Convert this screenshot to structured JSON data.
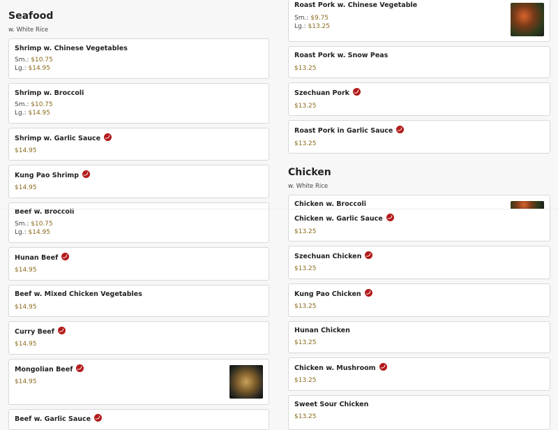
{
  "seafood": {
    "title": "Seafood",
    "subtitle": "w. White Rice",
    "items": [
      {
        "name": "Shrimp w. Chinese Vegetables",
        "sm_label": "Sm.:",
        "sm": "$10.75",
        "lg_label": "Lg.:",
        "lg": "$14.95"
      },
      {
        "name": "Shrimp w. Broccoli",
        "sm_label": "Sm.:",
        "sm": "$10.75",
        "lg_label": "Lg.:",
        "lg": "$14.95"
      },
      {
        "name": "Shrimp w. Garlic Sauce",
        "price": "$14.95"
      },
      {
        "name": "Kung Pao Shrimp",
        "price": "$14.95"
      }
    ]
  },
  "beef": {
    "items": [
      {
        "name": "Beef w. Broccoli",
        "sm_label": "Sm.:",
        "sm": "$10.75",
        "lg_label": "Lg.:",
        "lg": "$14.95"
      },
      {
        "name": "Hunan Beef",
        "price": "$14.95"
      },
      {
        "name": "Beef w. Mixed Chicken Vegetables",
        "price": "$14.95"
      },
      {
        "name": "Curry Beef",
        "price": "$14.95"
      },
      {
        "name": "Mongolian Beef",
        "price": "$14.95"
      },
      {
        "name": "Beef w. Garlic Sauce"
      }
    ]
  },
  "pork": {
    "items": [
      {
        "name": "Roast Pork w. Chinese Vegetable",
        "sm_label": "Sm.:",
        "sm": "$9.75",
        "lg_label": "Lg.:",
        "lg": "$13.25"
      },
      {
        "name": "Roast Pork w. Snow Peas",
        "price": "$13.25"
      },
      {
        "name": "Szechuan Pork",
        "price": "$13.25"
      },
      {
        "name": "Roast Pork in Garlic Sauce",
        "price": "$13.25"
      }
    ]
  },
  "chicken": {
    "title": "Chicken",
    "subtitle": "w. White Rice",
    "items": [
      {
        "name": "Chicken w. Broccoli"
      },
      {
        "name": "Chicken w. Garlic Sauce",
        "price": "$13.25"
      },
      {
        "name": "Szechuan Chicken",
        "price": "$13.25"
      },
      {
        "name": "Kung Pao Chicken",
        "price": "$13.25"
      },
      {
        "name": "Hunan Chicken",
        "price": "$13.25"
      },
      {
        "name": "Chicken w. Mushroom",
        "price": "$13.25"
      },
      {
        "name": "Sweet Sour Chicken",
        "price": "$13.25"
      }
    ]
  },
  "icons": {
    "spicy": "spicy-pepper-icon",
    "photo": "dish-photo"
  },
  "colors": {
    "price": "#8a6a1a",
    "spicy": "#b31b1b",
    "card_border": "#d8d8d8",
    "background": "#f7f7f7"
  }
}
